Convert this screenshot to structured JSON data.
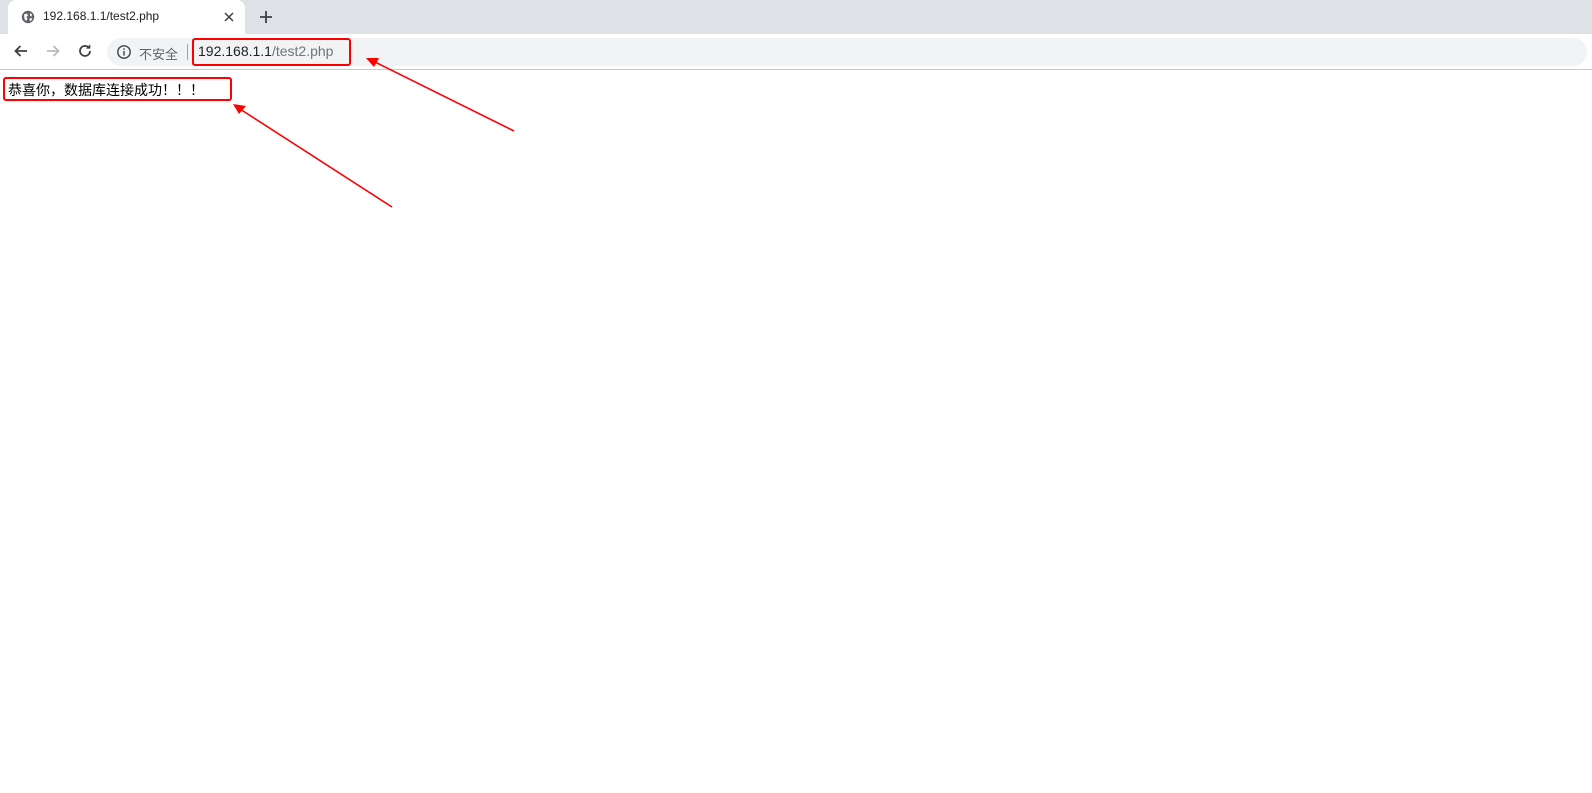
{
  "browser": {
    "tab": {
      "title": "192.168.1.1/test2.php",
      "favicon": "globe-icon"
    },
    "address_bar": {
      "security_label": "不安全",
      "url_host": "192.168.1.1",
      "url_path": "/test2.php"
    },
    "icons": {
      "back": "arrow-left-icon",
      "forward": "arrow-right-icon",
      "reload": "reload-icon",
      "new_tab": "plus-icon",
      "close_tab": "close-icon",
      "site_info": "info-icon"
    }
  },
  "page": {
    "message": "恭喜你，数据库连接成功！！！"
  },
  "annotations": {
    "color": "#ff0000"
  }
}
